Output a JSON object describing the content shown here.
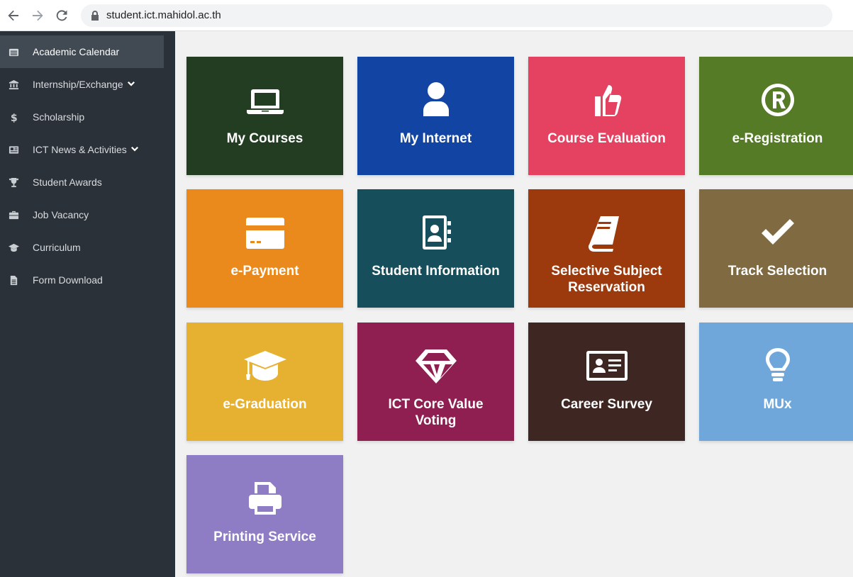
{
  "browser": {
    "url": "student.ict.mahidol.ac.th"
  },
  "sidebar": {
    "items": [
      {
        "label": "Academic Calendar",
        "icon": "calendar-list-icon"
      },
      {
        "label": "Internship/Exchange",
        "icon": "bank-icon",
        "has_dropdown": true
      },
      {
        "label": "Scholarship",
        "icon": "dollar-icon"
      },
      {
        "label": "ICT News & Activities",
        "icon": "newspaper-icon",
        "has_dropdown": true
      },
      {
        "label": "Student Awards",
        "icon": "trophy-icon"
      },
      {
        "label": "Job Vacancy",
        "icon": "briefcase-icon"
      },
      {
        "label": "Curriculum",
        "icon": "graduation-cap-icon"
      },
      {
        "label": "Form Download",
        "icon": "file-icon"
      }
    ]
  },
  "tiles": [
    {
      "label": "My Courses",
      "color": "#233d23",
      "icon": "laptop-icon"
    },
    {
      "label": "My Internet",
      "color": "#1245a3",
      "icon": "user-icon"
    },
    {
      "label": "Course Evaluation",
      "color": "#e54160",
      "icon": "thumbs-up-icon"
    },
    {
      "label": "e-Registration",
      "color": "#557b27",
      "icon": "registered-icon"
    },
    {
      "label": "e-Payment",
      "color": "#ea8a1c",
      "icon": "credit-card-icon"
    },
    {
      "label": "Student Information",
      "color": "#164e5c",
      "icon": "address-book-icon"
    },
    {
      "label": "Selective Subject Reservation",
      "color": "#9c3a0d",
      "icon": "book-icon"
    },
    {
      "label": "Track Selection",
      "color": "#7f6a41",
      "icon": "check-icon"
    },
    {
      "label": "e-Graduation",
      "color": "#e6b030",
      "icon": "graduation-cap-icon"
    },
    {
      "label": "ICT Core Value Voting",
      "color": "#8e1f50",
      "icon": "diamond-icon"
    },
    {
      "label": "Career Survey",
      "color": "#3e2723",
      "icon": "id-card-icon"
    },
    {
      "label": "MUx",
      "color": "#6fa7db",
      "icon": "lightbulb-icon"
    },
    {
      "label": "Printing Service",
      "color": "#8e7cc4",
      "icon": "printer-icon"
    }
  ]
}
